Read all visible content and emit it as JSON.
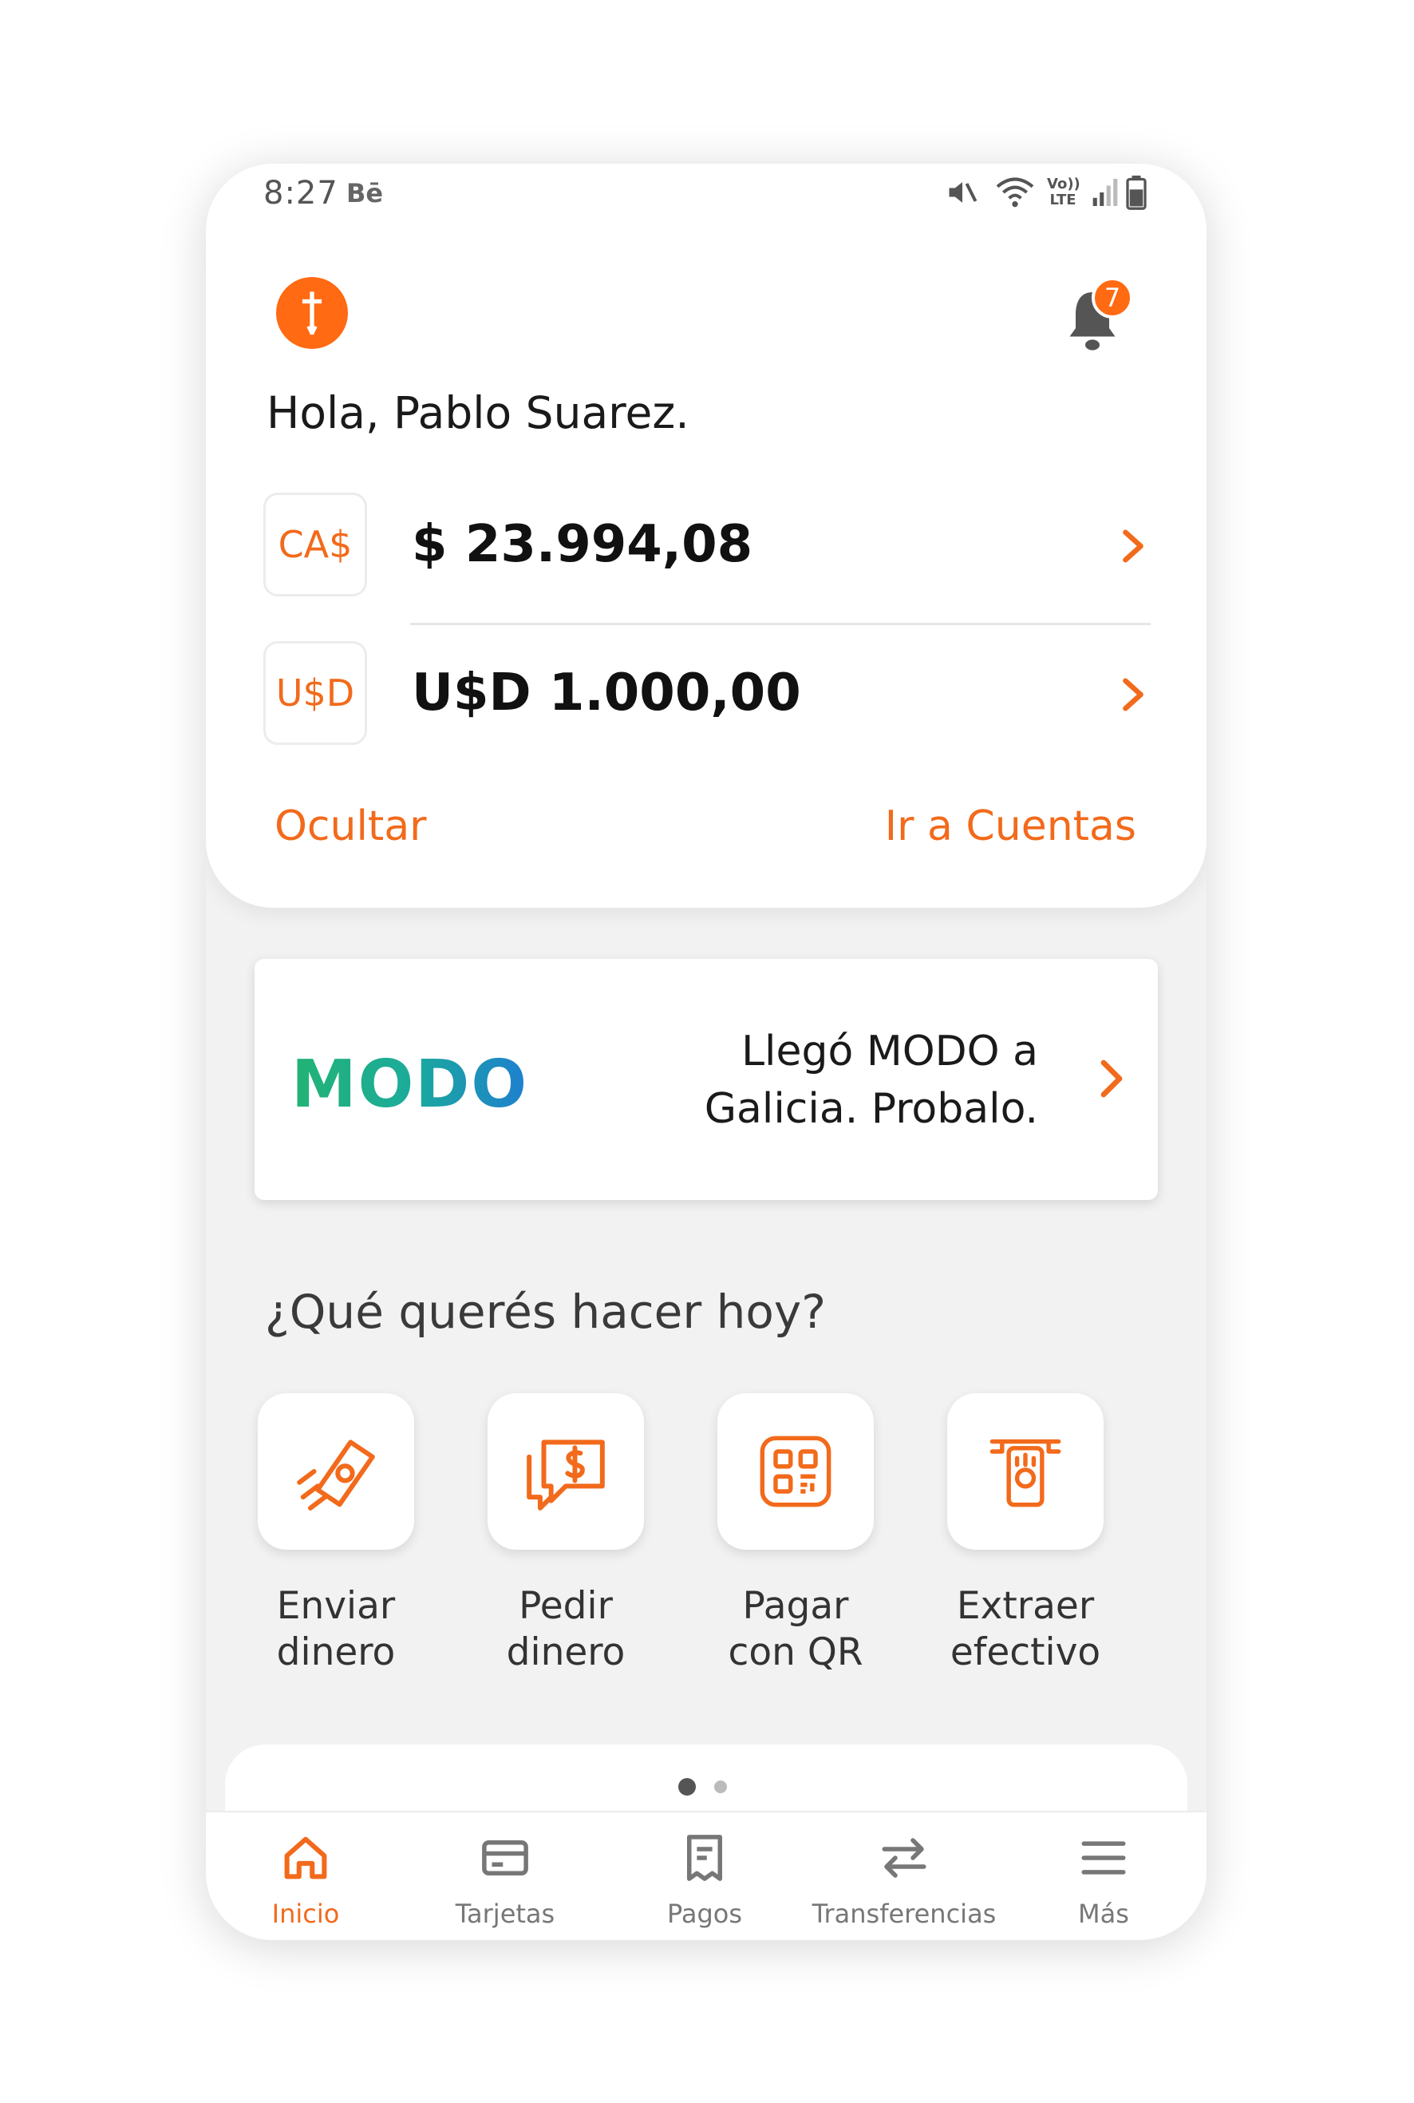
{
  "status_bar": {
    "time": "8:27",
    "indicator": "Bē",
    "icons": [
      "mute-icon",
      "wifi-icon",
      "volte-icon",
      "signal-icon",
      "battery-icon"
    ],
    "volte_label_top": "Vo))",
    "volte_label_bottom": "LTE"
  },
  "header": {
    "logo": "bank-logo-icon",
    "notifications_count": "7",
    "greeting": "Hola, Pablo Suarez."
  },
  "accounts": [
    {
      "currency": "CA$",
      "balance": "$ 23.994,08"
    },
    {
      "currency": "U$D",
      "balance": "U$D 1.000,00"
    }
  ],
  "account_actions": {
    "hide": "Ocultar",
    "go_to_accounts": "Ir a Cuentas"
  },
  "promo": {
    "brand": "MODO",
    "message_line1": "Llegó MODO a",
    "message_line2": "Galicia. Probalo."
  },
  "quick_actions": {
    "title": "¿Qué querés hacer hoy?",
    "items": [
      {
        "line1": "Enviar",
        "line2": "dinero",
        "icon": "send-money-icon"
      },
      {
        "line1": "Pedir",
        "line2": "dinero",
        "icon": "request-money-icon"
      },
      {
        "line1": "Pagar",
        "line2": "con QR",
        "icon": "qr-payment-icon"
      },
      {
        "line1": "Extraer",
        "line2": "efectivo",
        "icon": "cash-withdraw-icon"
      }
    ]
  },
  "carousel": {
    "pages": 2,
    "active_page": 1
  },
  "nav": [
    {
      "label": "Inicio",
      "icon": "home-icon",
      "active": true
    },
    {
      "label": "Tarjetas",
      "icon": "card-icon",
      "active": false
    },
    {
      "label": "Pagos",
      "icon": "receipt-icon",
      "active": false
    },
    {
      "label": "Transferencias",
      "icon": "transfer-icon",
      "active": false
    },
    {
      "label": "Más",
      "icon": "menu-icon",
      "active": false
    }
  ],
  "colors": {
    "accent": "#f26a1b",
    "logo_orange": "#ff6a13",
    "background": "#f2f2f2",
    "card": "#ffffff",
    "modo_green": "#22b374",
    "modo_blue": "#1e7fd0"
  }
}
